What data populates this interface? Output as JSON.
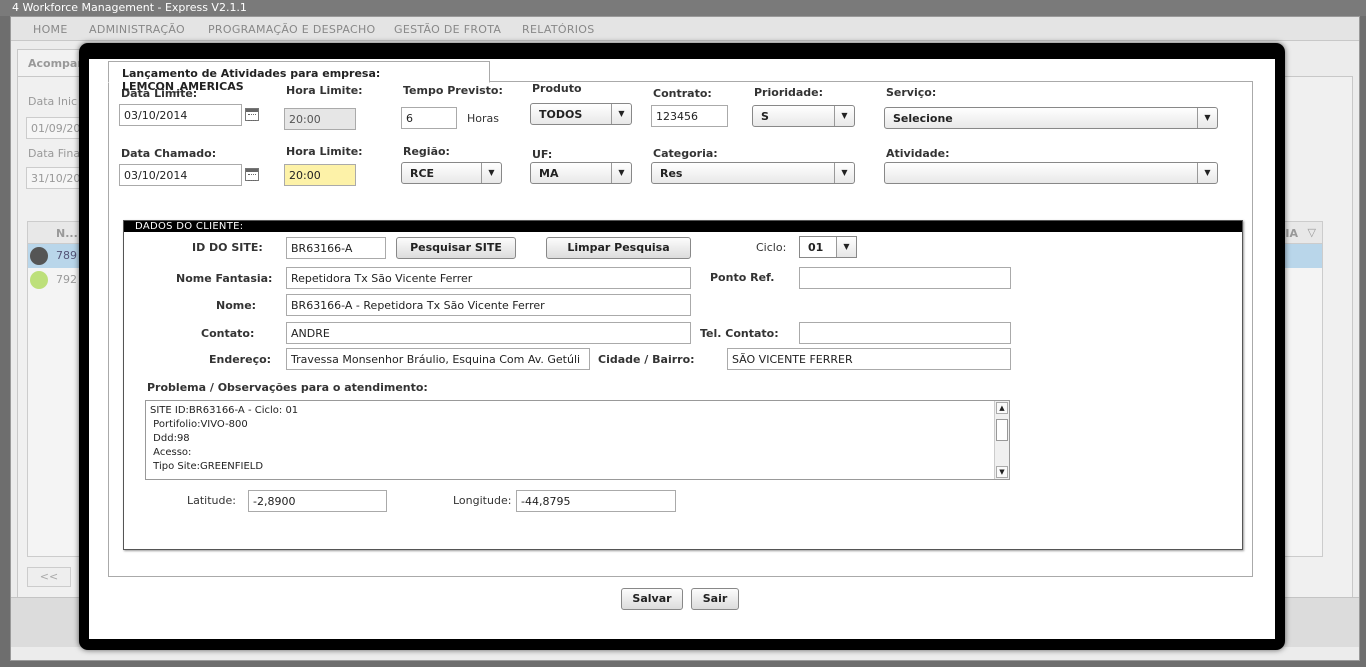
{
  "window": {
    "title": "4 Workforce Management - Express V2.1.1"
  },
  "menu": [
    "HOME",
    "ADMINISTRAÇÃO",
    "PROGRAMAÇÃO E DESPACHO",
    "GESTÃO DE FROTA",
    "RELATÓRIOS"
  ],
  "background": {
    "tab": "Acompan",
    "data_inicio_label": "Data Inic",
    "data_inicio_value": "01/09/20",
    "data_final_label": "Data Fina",
    "data_final_value": "31/10/20",
    "grid_head": "N...",
    "grid_head_right": "IA",
    "row1_id": "789",
    "row2_id": "792",
    "prev_button": "<<"
  },
  "modal": {
    "tab_title": "Lançamento de Atividades para empresa: LEMCON_AMERICAS",
    "labels": {
      "data_limite": "Data Limite:",
      "hora_limite": "Hora Limite:",
      "tempo_previsto": "Tempo Previsto:",
      "produto": "Produto",
      "contrato": "Contrato:",
      "prioridade": "Prioridade:",
      "servico": "Serviço:",
      "data_chamado": "Data Chamado:",
      "hora_limite2": "Hora Limite:",
      "regiao": "Região:",
      "uf": "UF:",
      "categoria": "Categoria:",
      "atividade": "Atividade:",
      "horas": "Horas"
    },
    "values": {
      "data_limite": "03/10/2014",
      "hora_limite": "20:00",
      "tempo_previsto": "6",
      "produto": "TODOS",
      "contrato": "123456",
      "prioridade": "S",
      "servico": "Selecione",
      "data_chamado": "03/10/2014",
      "hora_limite2": "20:00",
      "regiao": "RCE",
      "uf": "MA",
      "categoria": "Res",
      "atividade": ""
    },
    "cliente": {
      "section_title": "DADOS DO CLIENTE:",
      "id_site_label": "ID DO SITE:",
      "id_site_value": "BR63166-A",
      "pesquisar_button": "Pesquisar SITE",
      "limpar_button": "Limpar Pesquisa",
      "ciclo_label": "Ciclo:",
      "ciclo_value": "01",
      "nome_fantasia_label": "Nome Fantasia:",
      "nome_fantasia_value": "Repetidora Tx São Vicente Ferrer",
      "ponto_ref_label": "Ponto Ref.",
      "ponto_ref_value": "",
      "nome_label": "Nome:",
      "nome_value": "BR63166-A - Repetidora Tx São Vicente Ferrer",
      "contato_label": "Contato:",
      "contato_value": "ANDRE",
      "tel_contato_label": "Tel. Contato:",
      "tel_contato_value": "",
      "endereco_label": "Endereço:",
      "endereco_value": "Travessa Monsenhor Bráulio, Esquina Com Av. Getúli",
      "cidade_label": "Cidade / Bairro:",
      "cidade_value": "SÃO VICENTE FERRER",
      "problema_label": "Problema / Observações para o atendimento:",
      "problema_lines": [
        "SITE ID:BR63166-A - Ciclo: 01",
        " Portifolio:VIVO-800",
        " Ddd:98",
        " Acesso:",
        " Tipo Site:GREENFIELD"
      ],
      "latitude_label": "Latitude:",
      "latitude_value": "-2,8900",
      "longitude_label": "Longitude:",
      "longitude_value": "-44,8795"
    },
    "buttons": {
      "salvar": "Salvar",
      "sair": "Sair"
    }
  }
}
